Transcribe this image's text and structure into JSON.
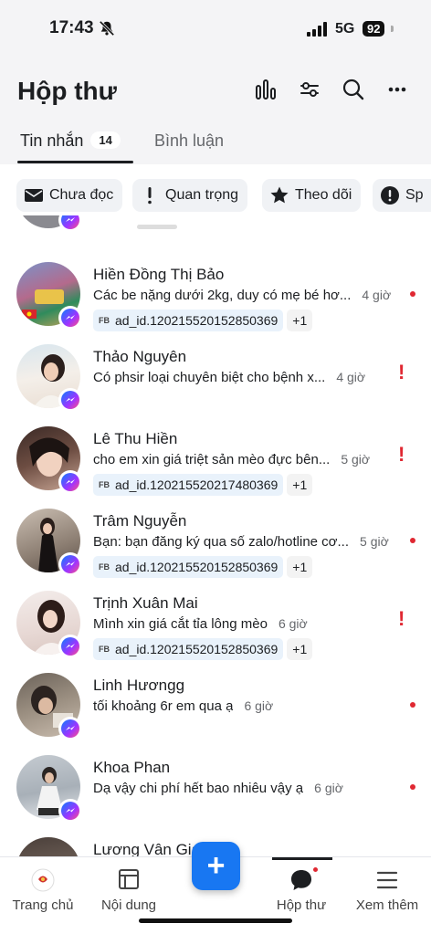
{
  "status_bar": {
    "time": "17:43",
    "network": "5G",
    "battery": "92"
  },
  "header": {
    "title": "Hộp thư"
  },
  "tabs": [
    {
      "label": "Tin nhắn",
      "count": "14",
      "active": true
    },
    {
      "label": "Bình luận",
      "active": false
    }
  ],
  "filters": [
    {
      "label": "Chưa đọc",
      "icon": "envelope-icon"
    },
    {
      "label": "Quan trọng",
      "icon": "exclamation-icon"
    },
    {
      "label": "Theo dõi",
      "icon": "star-icon"
    },
    {
      "label": "Sp",
      "icon": "alert-circle-icon"
    }
  ],
  "conversations": [
    {
      "name": "Hiền Đồng Thị Bảo",
      "preview": "Các be nặng dưới 2kg, duy có mẹ bé hơ...",
      "time": "4 giờ",
      "tag": "ad_id.120215520152850369",
      "tag_source": "FB",
      "more": "+1",
      "status": "unread-dot"
    },
    {
      "name": "Thảo Nguyên",
      "preview": "Có phsir loại chuyên biệt cho bệnh x...",
      "time": "4 giờ",
      "status": "important"
    },
    {
      "name": "Lê Thu Hiền",
      "preview": "cho em xin giá triệt sản mèo đực bên...",
      "time": "5 giờ",
      "tag": "ad_id.120215520217480369",
      "tag_source": "FB",
      "more": "+1",
      "status": "important"
    },
    {
      "name": "Trâm Nguyễn",
      "preview": "Bạn: bạn đăng ký qua số zalo/hotline cơ...",
      "time": "5 giờ",
      "tag": "ad_id.120215520152850369",
      "tag_source": "FB",
      "more": "+1",
      "status": "unread-dot"
    },
    {
      "name": "Trịnh Xuân Mai",
      "preview": "Mình xin giá cắt tỉa lông mèo",
      "time": "6 giờ",
      "tag": "ad_id.120215520152850369",
      "tag_source": "FB",
      "more": "+1",
      "status": "important"
    },
    {
      "name": "Linh Hươngg",
      "preview": "tối khoảng 6r em qua ạ",
      "time": "6 giờ",
      "status": "unread-dot"
    },
    {
      "name": "Khoa Phan",
      "preview": "Dạ vậy chi phí hết bao nhiêu vậy ạ",
      "time": "6 giờ",
      "status": "unread-dot"
    },
    {
      "name": "Lương Vân Gia",
      "preview": "",
      "time": "",
      "status": ""
    }
  ],
  "fab": {
    "label": "+"
  },
  "bottom_nav": [
    {
      "label": "Trang chủ",
      "icon": "page-logo-icon"
    },
    {
      "label": "Nội dung",
      "icon": "content-icon"
    },
    {
      "label": "Hộp thư",
      "icon": "chat-bubble-icon",
      "active": true
    },
    {
      "label": "Xem thêm",
      "icon": "menu-icon"
    }
  ],
  "colors": {
    "accent": "#1877f2",
    "alert": "#e02832",
    "tag_bg": "#e9f2fb"
  }
}
